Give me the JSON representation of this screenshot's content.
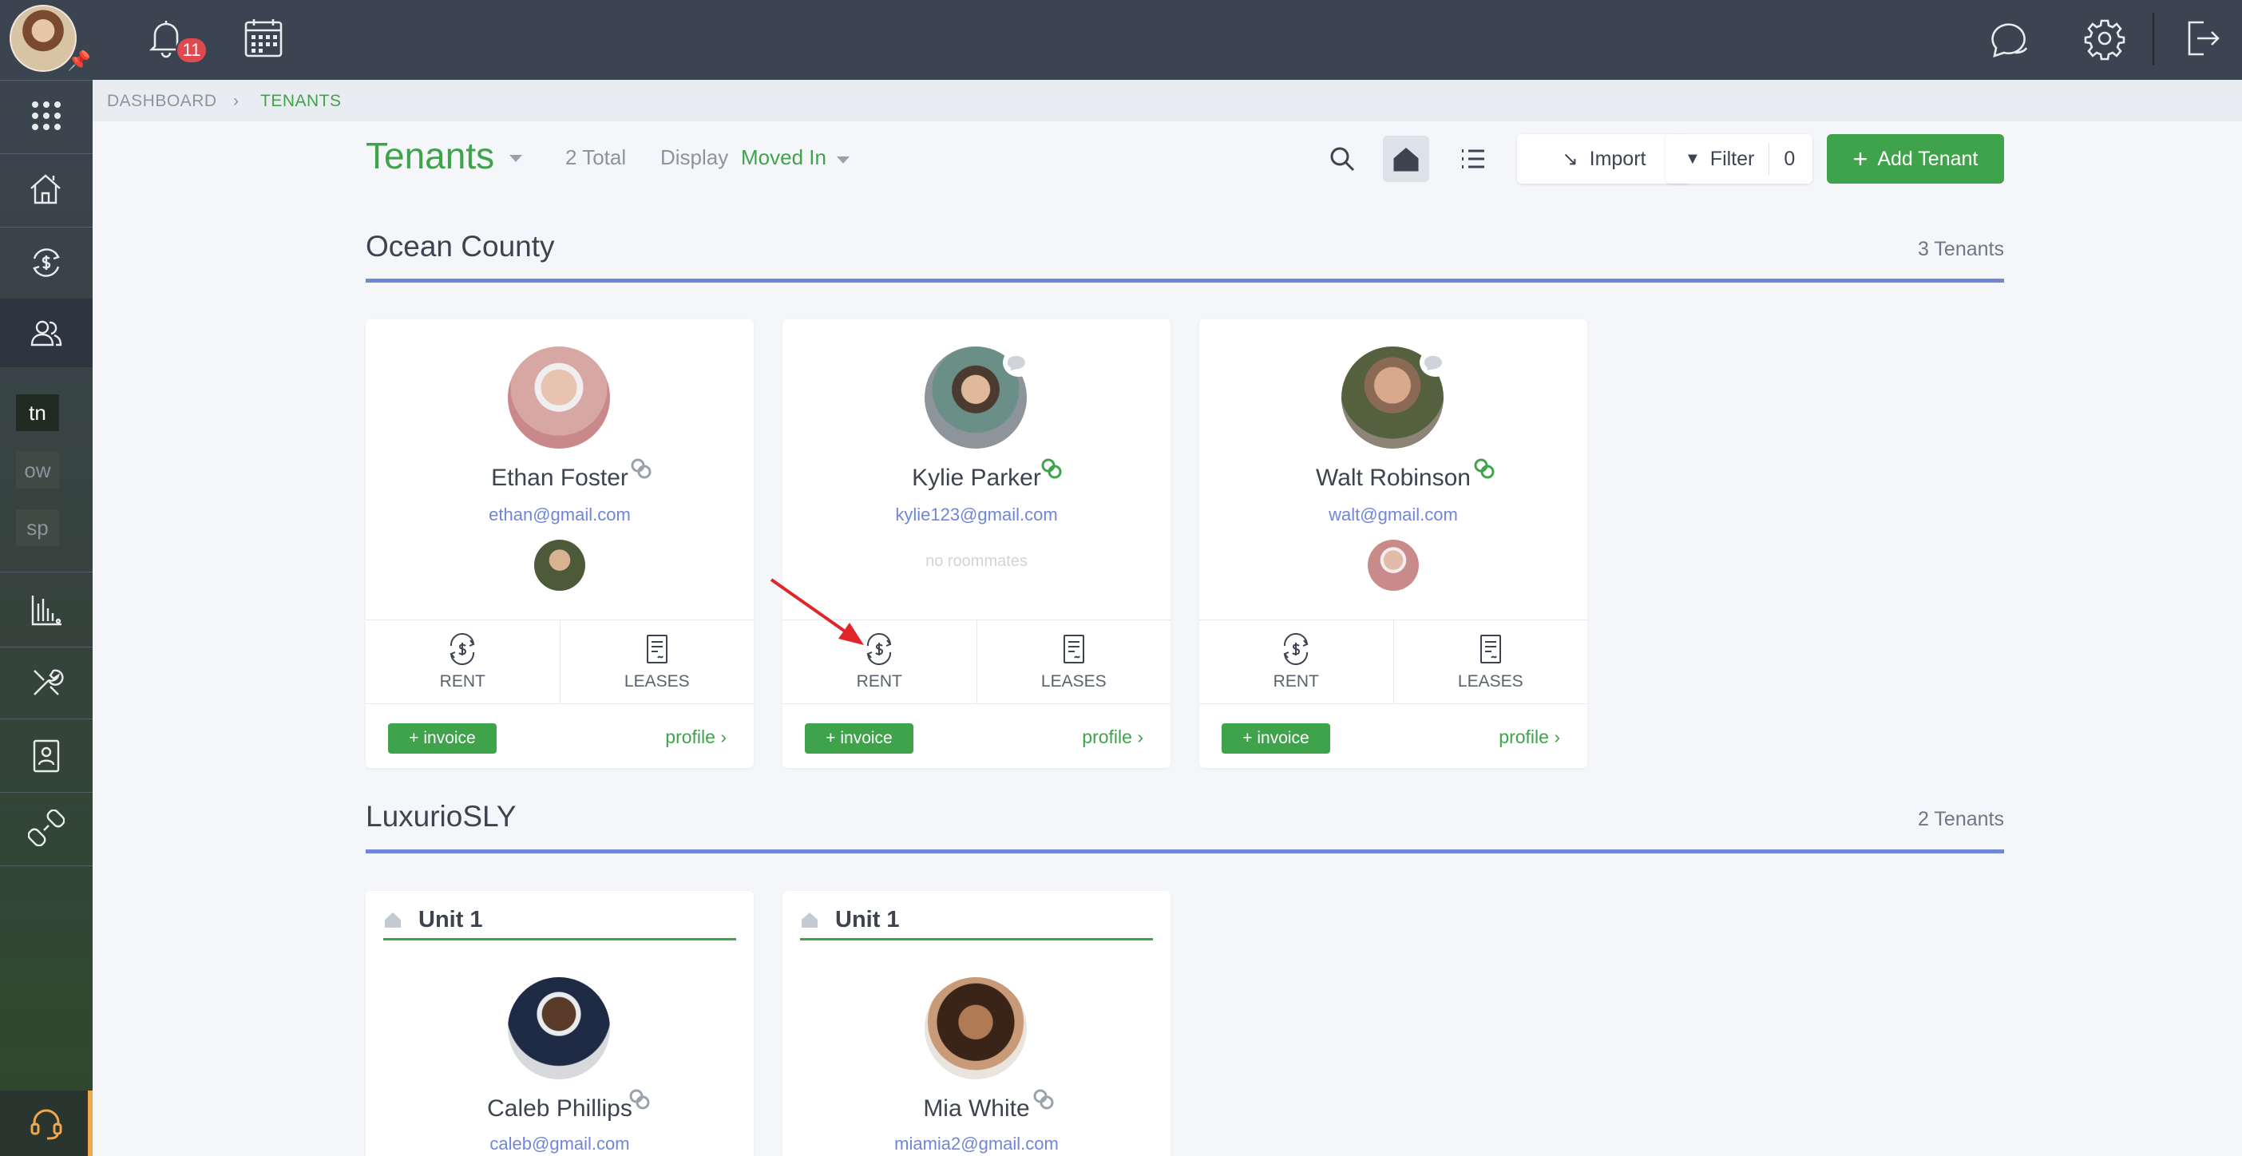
{
  "nav": {
    "notifications_count": "11",
    "sidebar_squares": [
      "tn",
      "ow",
      "sp"
    ]
  },
  "breadcrumb": {
    "items": [
      "DASHBOARD",
      "TENANTS"
    ]
  },
  "header": {
    "title": "Tenants",
    "total": "2 Total",
    "display_label": "Display",
    "display_value": "Moved In",
    "import_label": "Import",
    "filter_label": "Filter",
    "filter_count": "0",
    "add_label": "Add Tenant"
  },
  "sections": [
    {
      "name": "Ocean County",
      "count": "3 Tenants",
      "tenants": [
        {
          "name": "Ethan Foster",
          "email": "ethan@gmail.com",
          "roommates": "",
          "linked": "grey",
          "rent": "RENT",
          "leases": "LEASES",
          "invoice": "+ invoice",
          "profile": "profile"
        },
        {
          "name": "Kylie Parker",
          "email": "kylie123@gmail.com",
          "roommates": "no roommates",
          "linked": "green",
          "rent": "RENT",
          "leases": "LEASES",
          "invoice": "+ invoice",
          "profile": "profile"
        },
        {
          "name": "Walt Robinson",
          "email": "walt@gmail.com",
          "roommates": "",
          "linked": "green",
          "rent": "RENT",
          "leases": "LEASES",
          "invoice": "+ invoice",
          "profile": "profile"
        }
      ]
    },
    {
      "name": "LuxurioSLY",
      "count": "2 Tenants",
      "tenants": [
        {
          "unit": "Unit 1",
          "name": "Caleb Phillips",
          "email": "caleb@gmail.com"
        },
        {
          "unit": "Unit 1",
          "name": "Mia White",
          "email": "miamia2@gmail.com"
        }
      ]
    }
  ],
  "colors": {
    "accent_green": "#3fa34b",
    "section_line": "#6f86d9",
    "badge_red": "#e0494e",
    "topbar": "#3b4552"
  }
}
